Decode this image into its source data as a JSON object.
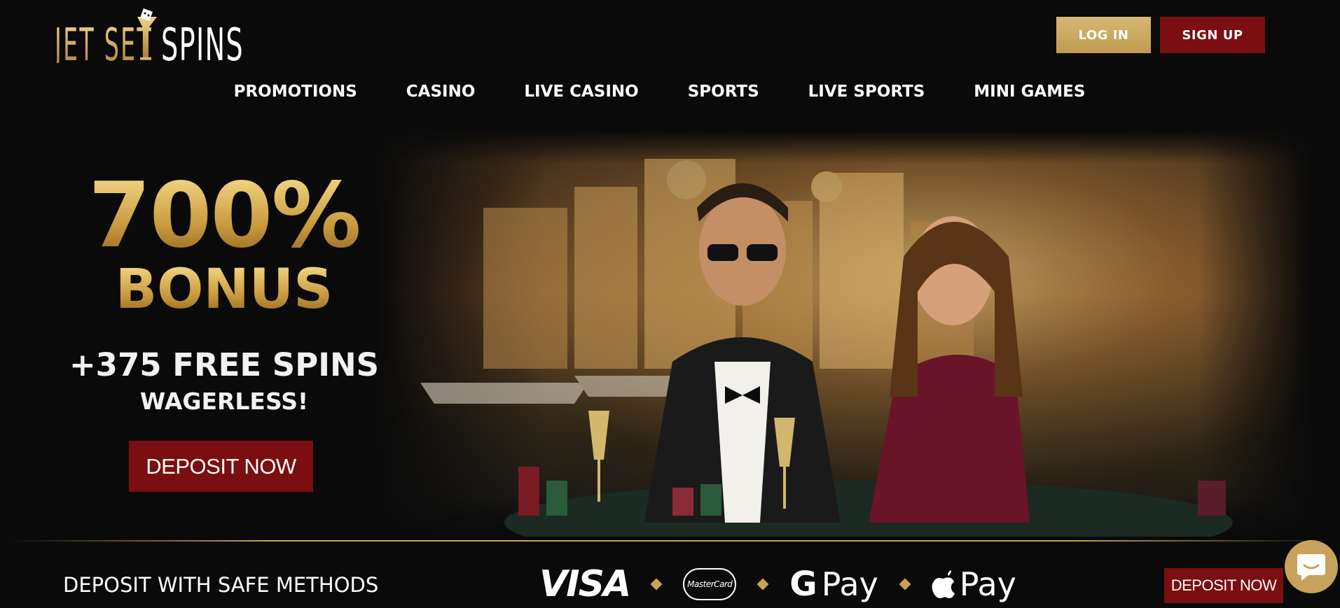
{
  "brand": {
    "logo_text_left": "JET SET",
    "logo_text_right": "SPINS",
    "gold": "#c9a25a",
    "red": "#7a0e10"
  },
  "header": {
    "login_label": "LOG IN",
    "signup_label": "SIGN UP"
  },
  "nav": {
    "items": [
      "PROMOTIONS",
      "CASINO",
      "LIVE CASINO",
      "SPORTS",
      "LIVE SPORTS",
      "MINI GAMES"
    ]
  },
  "hero": {
    "percent": "700%",
    "bonus": "BONUS",
    "spins": "+375 FREE SPINS",
    "wagerless": "WAGERLESS!",
    "cta_label": "DEPOSIT NOW"
  },
  "footer": {
    "safe_methods": "DEPOSIT WITH SAFE METHODS",
    "visa": "VISA",
    "mastercard": "MasterCard",
    "gpay_g": "G",
    "gpay_text": "Pay",
    "applepay_text": "Pay",
    "cta_label": "DEPOSIT NOW"
  },
  "icons": {
    "chat": "chat-icon",
    "apple": "apple-icon"
  }
}
